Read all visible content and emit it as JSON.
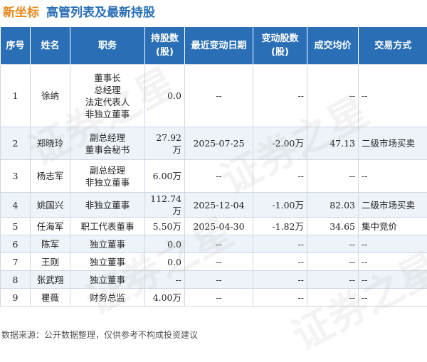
{
  "header": {
    "brand": "新坐标",
    "title": "高管列表及最新持股"
  },
  "columns": [
    "序号",
    "姓名",
    "职务",
    "持股数",
    "(股)",
    "最近变动日期",
    "变动股数",
    "(股)",
    "成交均价",
    "交易方式"
  ],
  "rows": [
    {
      "idx": "1",
      "name": "徐纳",
      "roles": [
        "董事长",
        "总经理",
        "法定代表人",
        "非独立董事"
      ],
      "shares": "0.0",
      "date": "--",
      "change": "--",
      "price": "--",
      "method": "--"
    },
    {
      "idx": "2",
      "name": "郑晓玲",
      "roles": [
        "副总经理",
        "董事会秘书"
      ],
      "shares": "27.92万",
      "date": "2025-07-25",
      "change": "-2.00万",
      "price": "47.13",
      "method": "二级市场买卖"
    },
    {
      "idx": "3",
      "name": "杨志军",
      "roles": [
        "副总经理",
        "非独立董事"
      ],
      "shares": "6.00万",
      "date": "--",
      "change": "--",
      "price": "--",
      "method": "--"
    },
    {
      "idx": "4",
      "name": "姚国兴",
      "roles": [
        "非独立董事"
      ],
      "shares": "112.74万",
      "date": "2025-12-04",
      "change": "-1.00万",
      "price": "82.03",
      "method": "二级市场买卖"
    },
    {
      "idx": "5",
      "name": "任海军",
      "roles": [
        "职工代表董事"
      ],
      "shares": "5.50万",
      "date": "2025-04-30",
      "change": "-1.82万",
      "price": "34.65",
      "method": "集中竞价"
    },
    {
      "idx": "6",
      "name": "陈军",
      "roles": [
        "独立董事"
      ],
      "shares": "0.0",
      "date": "--",
      "change": "--",
      "price": "--",
      "method": "--"
    },
    {
      "idx": "7",
      "name": "王刚",
      "roles": [
        "独立董事"
      ],
      "shares": "0.0",
      "date": "--",
      "change": "--",
      "price": "--",
      "method": "--"
    },
    {
      "idx": "8",
      "name": "张武翔",
      "roles": [
        "独立董事"
      ],
      "shares": "--",
      "date": "--",
      "change": "--",
      "price": "--",
      "method": "--"
    },
    {
      "idx": "9",
      "name": "瞿薇",
      "roles": [
        "财务总监"
      ],
      "shares": "4.00万",
      "date": "--",
      "change": "--",
      "price": "--",
      "method": "--"
    }
  ],
  "watermark": "证券之星",
  "footer": "数据来源：公开数据整理，仅供参考不构成投资建议"
}
